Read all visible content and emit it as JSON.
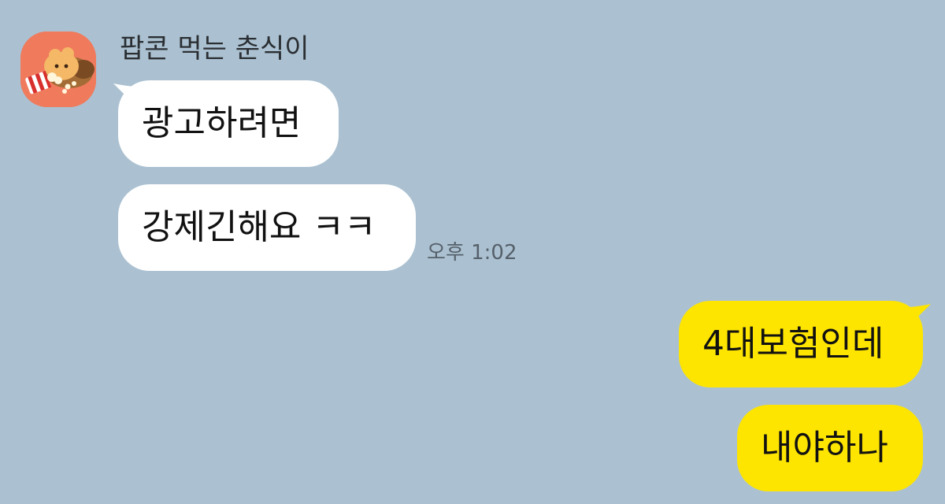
{
  "chat": {
    "background_color": "#abc1d1",
    "incoming_bubble_color": "#ffffff",
    "outgoing_bubble_color": "#fee500"
  },
  "sender": {
    "name": "팝콘 먹는 춘식이",
    "avatar_icon": "popcorn-character-icon"
  },
  "messages": {
    "incoming": [
      {
        "text": "광고하려면"
      },
      {
        "text": "강제긴해요 ㅋㅋ"
      }
    ],
    "incoming_time": "오후 1:02",
    "outgoing": [
      {
        "text": "4대보험인데"
      },
      {
        "text": "내야하나"
      }
    ]
  }
}
